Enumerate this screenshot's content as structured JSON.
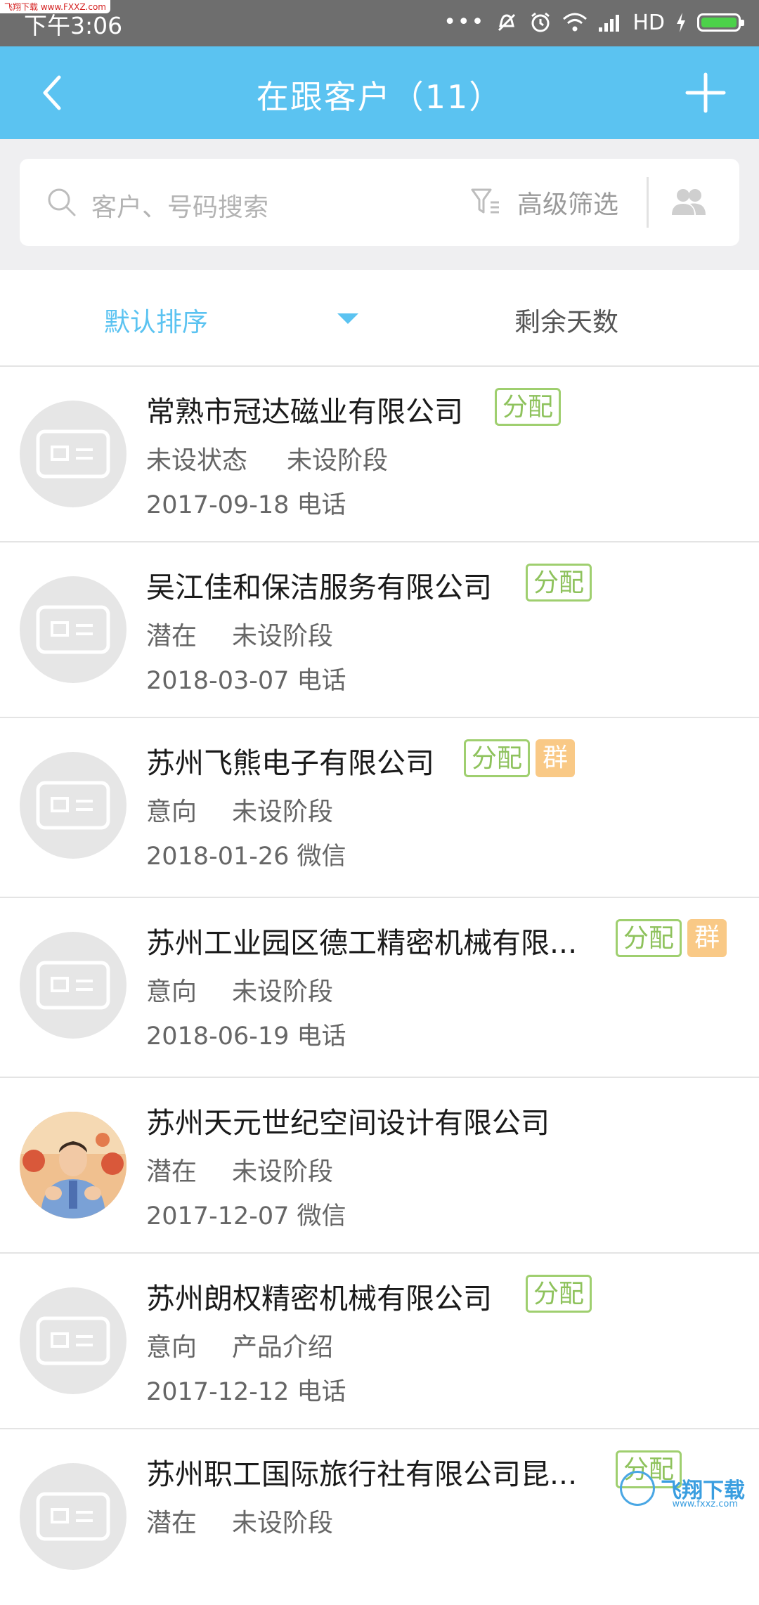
{
  "statusbar": {
    "time": "下午3:06",
    "watermark": "飞翔下载 www.FXXZ.com",
    "dots": "•••",
    "network": "HD",
    "battery_level": 1.0,
    "battery_color": "#4cd24a"
  },
  "appbar": {
    "title": "在跟客户（11）",
    "back_icon": "chevron-left-icon",
    "add_icon": "plus-icon",
    "color": "#5bc3f1"
  },
  "search": {
    "placeholder": "客户、号码搜索",
    "filter_label": "高级筛选"
  },
  "sort": {
    "default_label": "默认排序",
    "days_label": "剩余天数",
    "active_color": "#5bc3f1"
  },
  "customers": [
    {
      "name": "常熟市冠达磁业有限公司",
      "tags": [
        "分配"
      ],
      "group": "",
      "status": "未设状态",
      "stage": "未设阶段",
      "date": "2017-09-18",
      "channel": "电话",
      "photo": false
    },
    {
      "name": "吴江佳和保洁服务有限公司",
      "tags": [
        "分配"
      ],
      "group": "",
      "status": "潜在",
      "stage": "未设阶段",
      "date": "2018-03-07",
      "channel": "电话",
      "photo": false
    },
    {
      "name": "苏州飞熊电子有限公司",
      "tags": [
        "分配"
      ],
      "group": "群",
      "status": "意向",
      "stage": "未设阶段",
      "date": "2018-01-26",
      "channel": "微信",
      "photo": false
    },
    {
      "name": "苏州工业园区德工精密机械有限...",
      "tags": [
        "分配"
      ],
      "group": "群",
      "status": "意向",
      "stage": "未设阶段",
      "date": "2018-06-19",
      "channel": "电话",
      "photo": false
    },
    {
      "name": "苏州天元世纪空间设计有限公司",
      "tags": [],
      "group": "",
      "status": "潜在",
      "stage": "未设阶段",
      "date": "2017-12-07",
      "channel": "微信",
      "photo": true
    },
    {
      "name": "苏州朗权精密机械有限公司",
      "tags": [
        "分配"
      ],
      "group": "",
      "status": "意向",
      "stage": "产品介绍",
      "date": "2017-12-12",
      "channel": "电话",
      "photo": false
    },
    {
      "name": "苏州职工国际旅行社有限公司昆...",
      "tags": [
        "分配"
      ],
      "group": "",
      "status": "潜在",
      "stage": "未设阶段",
      "date": "",
      "channel": "",
      "photo": false
    }
  ],
  "watermark_bottom": {
    "text": "飞翔下载",
    "sub": "www.fxxz.com"
  }
}
